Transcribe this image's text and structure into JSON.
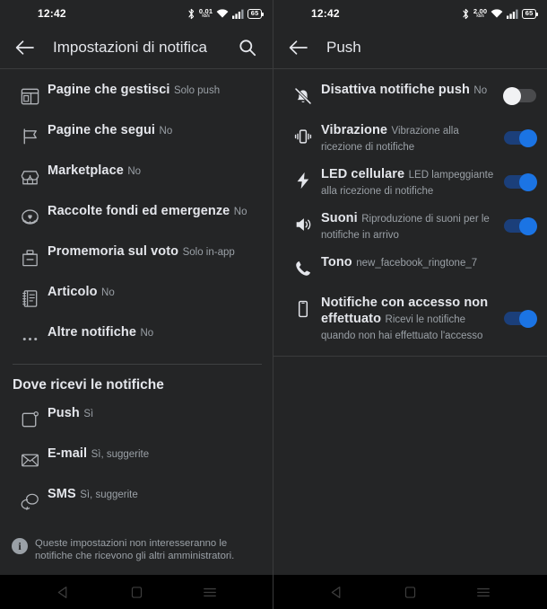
{
  "status_bar": {
    "time": "12:42",
    "net_speed_left": "0.01",
    "net_speed_right": "2.00",
    "net_speed_unit": "kb/s",
    "battery": "65",
    "icons": [
      "bluetooth-icon",
      "network-speed-icon",
      "wifi-icon",
      "cellular-signal-icon",
      "battery-icon"
    ]
  },
  "left_panel": {
    "app_bar": {
      "back_label": "back-arrow",
      "title": "Impostazioni di notifica",
      "search_label": "search"
    },
    "items": [
      {
        "icon": "pages-manage-icon",
        "title": "Pagine che gestisci",
        "subtitle": "Solo push"
      },
      {
        "icon": "flag-icon",
        "title": "Pagine che segui",
        "subtitle": "No"
      },
      {
        "icon": "marketplace-store-icon",
        "title": "Marketplace",
        "subtitle": "No"
      },
      {
        "icon": "fundraiser-heart-coin-icon",
        "title": "Raccolte fondi ed emergenze",
        "subtitle": "No"
      },
      {
        "icon": "ballot-box-icon",
        "title": "Promemoria sul voto",
        "subtitle": "Solo in-app"
      },
      {
        "icon": "article-notebook-icon",
        "title": "Articolo",
        "subtitle": "No"
      },
      {
        "icon": "ellipsis-icon",
        "title": "Altre notifiche",
        "subtitle": "No"
      }
    ],
    "section_title": "Dove ricevi le notifiche",
    "channels": [
      {
        "icon": "push-notification-icon",
        "title": "Push",
        "subtitle": "Sì"
      },
      {
        "icon": "envelope-icon",
        "title": "E-mail",
        "subtitle": "Sì, suggerite"
      },
      {
        "icon": "chat-bubbles-icon",
        "title": "SMS",
        "subtitle": "Sì, suggerite"
      }
    ],
    "footnote": "Queste impostazioni non interesseranno le notifiche che ricevono gli altri amministratori."
  },
  "right_panel": {
    "app_bar": {
      "back_label": "back-arrow",
      "title": "Push"
    },
    "items": [
      {
        "icon": "bell-slash-icon",
        "title": "Disattiva notifiche push",
        "subtitle": "No",
        "toggle": "off"
      },
      {
        "icon": "vibration-icon",
        "title": "Vibrazione",
        "subtitle": "Vibrazione alla ricezione di notifiche",
        "toggle": "on"
      },
      {
        "icon": "lightning-bolt-icon",
        "title": "LED cellulare",
        "subtitle": "LED lampeggiante alla ricezione di notifiche",
        "toggle": "on"
      },
      {
        "icon": "speaker-icon",
        "title": "Suoni",
        "subtitle": "Riproduzione di suoni per le notifiche in arrivo",
        "toggle": "on"
      },
      {
        "icon": "phone-handset-icon",
        "title": "Tono",
        "subtitle": "new_facebook_ringtone_7",
        "toggle": "none"
      },
      {
        "icon": "mobile-phone-icon",
        "title": "Notifiche con accesso non effettuato",
        "subtitle": "Ricevi le notifiche quando non hai effettuato l'accesso",
        "toggle": "on"
      }
    ]
  },
  "nav_bar": {
    "back": "nav-back-icon",
    "home": "nav-home-icon",
    "recents": "nav-recents-icon"
  },
  "colors": {
    "background": "#242526",
    "divider": "#3a3b3c",
    "primary_text": "#e4e6eb",
    "secondary_text": "#9aa0a6",
    "accent_on": "#1b74e4",
    "toggle_off_track": "#4a4b4d"
  }
}
